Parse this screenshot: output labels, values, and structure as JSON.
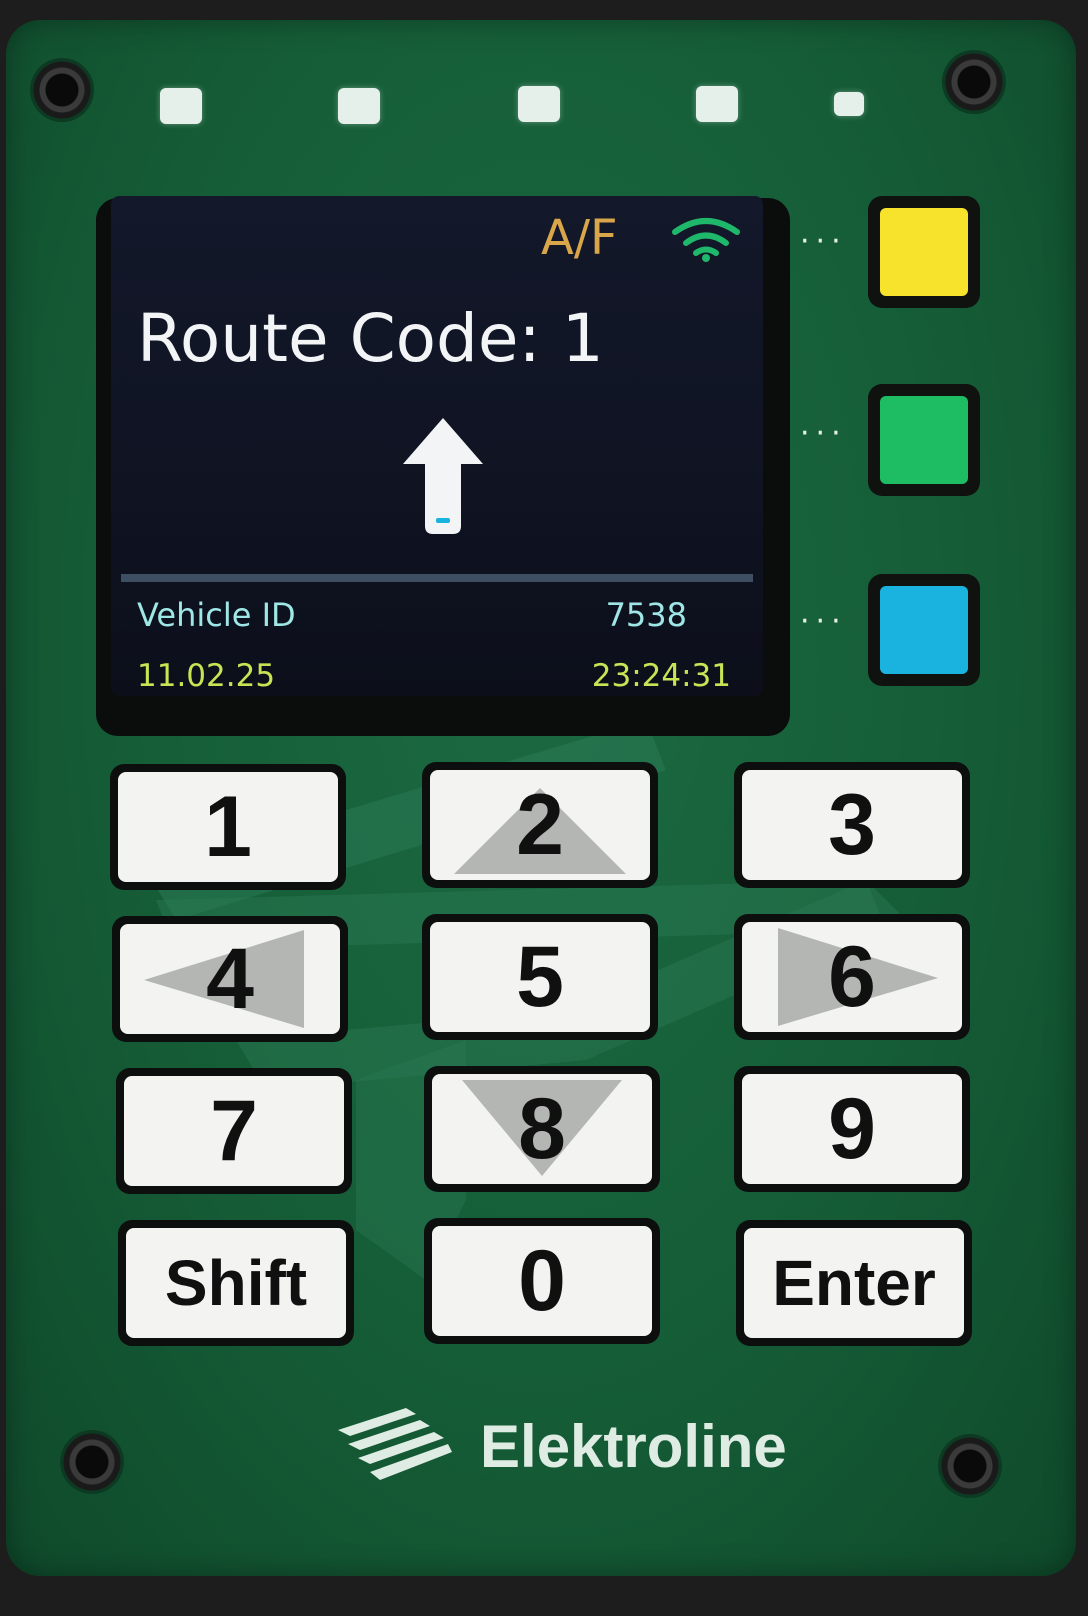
{
  "display": {
    "mode_indicator": "A/F",
    "signal_icon": "wifi-icon",
    "route_label": "Route Code: 1",
    "direction_icon": "arrow-up-icon",
    "vehicle_id_label": "Vehicle ID",
    "vehicle_id_value": "7538",
    "date": "11.02.25",
    "time": "23:24:31"
  },
  "status_leds": [
    "led-1",
    "led-2",
    "led-3",
    "led-4",
    "led-5"
  ],
  "side_buttons": [
    {
      "name": "yellow-function-button",
      "color": "#f7e22c"
    },
    {
      "name": "green-function-button",
      "color": "#1ebd63"
    },
    {
      "name": "blue-function-button",
      "color": "#1ab3e0"
    }
  ],
  "keypad": {
    "k1": "1",
    "k2": "2",
    "k3": "3",
    "k4": "4",
    "k5": "5",
    "k6": "6",
    "k7": "7",
    "k8": "8",
    "k9": "9",
    "shift": "Shift",
    "k0": "0",
    "enter": "Enter"
  },
  "brand": {
    "name": "Elektroline",
    "logo_icon": "elektroline-logo-icon"
  },
  "colors": {
    "panel": "#155d37",
    "screen": "#13182a",
    "route_text": "#f2f4f6",
    "vehicle_text": "#9fe6e6",
    "datetime_text": "#c8e455",
    "af_text": "#d9a74a",
    "wifi": "#1fb86a"
  }
}
